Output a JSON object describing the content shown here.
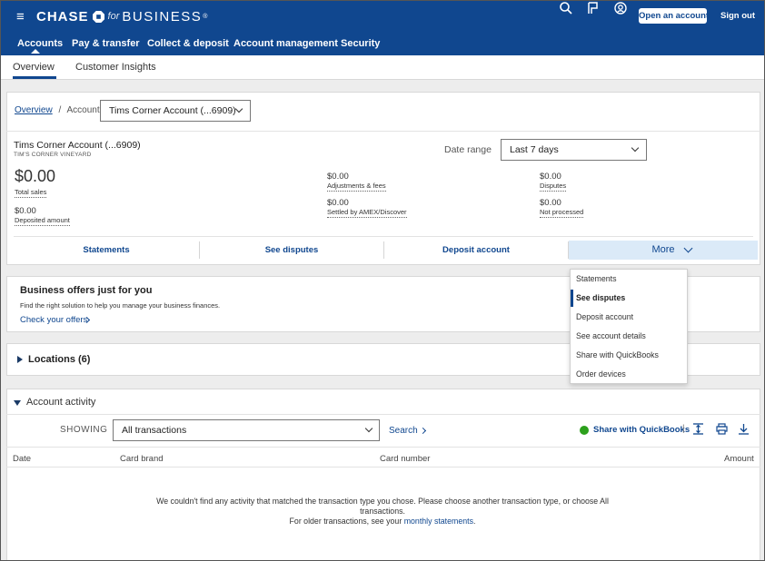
{
  "header": {
    "brand_chase": "CHASE",
    "brand_for": "for",
    "brand_business": "BUSINESS",
    "brand_tm": "®",
    "open_account": "Open an account",
    "sign_out": "Sign out",
    "nav": [
      "Accounts",
      "Pay & transfer",
      "Collect & deposit",
      "Account management",
      "Security"
    ]
  },
  "subnav": [
    "Overview",
    "Customer Insights"
  ],
  "breadcrumb": {
    "overview": "Overview",
    "sep": "/",
    "account": "Account"
  },
  "account_select": "Tims Corner Account (...6909)",
  "account": {
    "name": "Tims Corner Account (...6909)",
    "sub": "TIM'S CORNER VINEYARD",
    "date_range_label": "Date range",
    "date_range_value": "Last 7 days",
    "total_sales": "$0.00",
    "total_sales_label": "Total sales",
    "deposited": "$0.00",
    "deposited_label": "Deposited amount",
    "adjustments": "$0.00",
    "adjustments_label": "Adjustments & fees",
    "settled": "$0.00",
    "settled_label": "Settled by AMEX/Discover",
    "disputes": "$0.00",
    "disputes_label": "Disputes",
    "not_processed": "$0.00",
    "not_processed_label": "Not processed"
  },
  "actions": {
    "statements": "Statements",
    "see_disputes": "See disputes",
    "deposit_account": "Deposit account",
    "more": "More"
  },
  "dropdown": [
    "Statements",
    "See disputes",
    "Deposit account",
    "See account details",
    "Share with QuickBooks",
    "Order devices"
  ],
  "offers": {
    "title": "Business offers just for you",
    "desc": "Find the right solution to help you manage your business finances.",
    "link": "Check your offers"
  },
  "locations": {
    "title": "Locations (6)"
  },
  "activity": {
    "title": "Account activity",
    "showing": "SHOWING",
    "filter": "All transactions",
    "search": "Search",
    "share_qb": "Share with QuickBooks",
    "pipe": "|",
    "columns": [
      "Date",
      "Card brand",
      "Card number",
      "Amount"
    ],
    "empty_line1": "We couldn't find any activity that matched the transaction type you chose. Please choose another transaction type, or choose All transactions.",
    "empty_line2_prefix": "For older transactions, see your",
    "empty_line2_link": "monthly statements",
    "empty_line2_suffix": "."
  },
  "colors": {
    "brand_blue": "#10478f",
    "more_bg": "#dbeaf8",
    "quickbooks_green": "#2ca01c"
  },
  "icons": [
    "menu-icon",
    "search-icon",
    "flag-icon",
    "user-circle-icon",
    "chevron-down-icon",
    "chevron-right-icon",
    "expand-icon",
    "print-icon",
    "download-icon",
    "quickbooks-icon"
  ]
}
